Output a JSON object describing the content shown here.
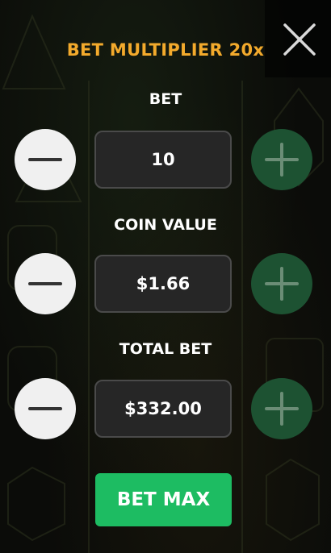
{
  "dialog": {
    "title": "BET MULTIPLIER 20x",
    "close_icon": "close-x-icon"
  },
  "controls": [
    {
      "key": "bet",
      "label": "BET",
      "value": "10"
    },
    {
      "key": "coin_value",
      "label": "COIN VALUE",
      "value": "$1.66"
    },
    {
      "key": "total_bet",
      "label": "TOTAL BET",
      "value": "$332.00"
    }
  ],
  "actions": {
    "bet_max_label": "BET MAX"
  },
  "icons": {
    "decrease": "minus-icon",
    "increase": "plus-icon"
  },
  "colors": {
    "title": "#f3aa2c",
    "bet_max": "#1dbc62",
    "plus_button": "#1d5232",
    "minus_button": "#f0f0f0",
    "value_box": "#262626"
  }
}
